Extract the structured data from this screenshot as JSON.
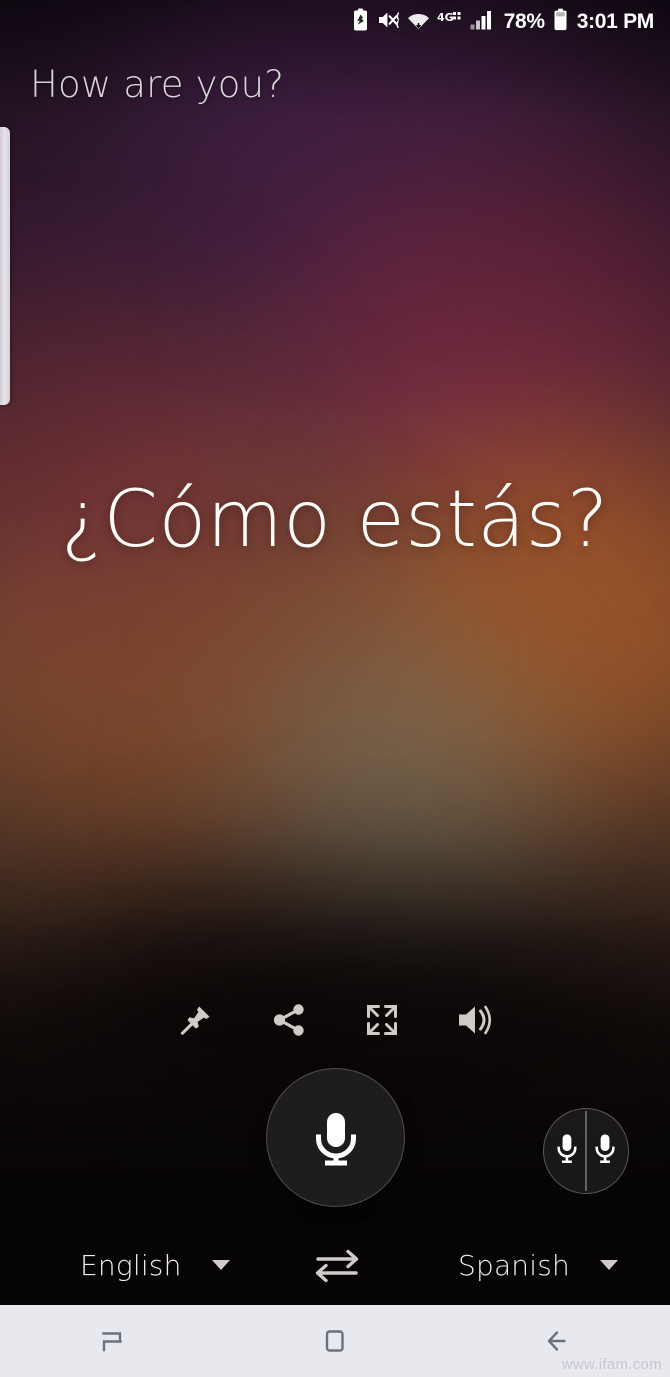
{
  "status_bar": {
    "battery_percent": "78%",
    "time": "3:01 PM",
    "network_label": "4G",
    "network_sub": "LTE",
    "icons": [
      "battery-saver-icon",
      "mute-vibrate-icon",
      "wifi-icon",
      "network-4g-lte-icon",
      "signal-bars-icon",
      "battery-icon"
    ]
  },
  "translation": {
    "source_text": "How are you?",
    "translated_text": "¿Cómo estás?"
  },
  "actions": [
    {
      "name": "pin-icon",
      "label": "Pin"
    },
    {
      "name": "share-icon",
      "label": "Share"
    },
    {
      "name": "fullscreen-icon",
      "label": "Fullscreen"
    },
    {
      "name": "speaker-icon",
      "label": "Listen"
    }
  ],
  "mic": {
    "main_label": "Microphone",
    "dual_label": "Conversation mode"
  },
  "languages": {
    "source": "English",
    "target": "Spanish",
    "swap_label": "Swap languages"
  },
  "navbar": {
    "recents_label": "Recents",
    "home_label": "Home",
    "back_label": "Back",
    "watermark": "www.ifam.com"
  },
  "colors": {
    "nav_background": "#e8e9ef",
    "nav_icon": "#6b6f80",
    "text_primary": "#fdfbf7",
    "accent_circle_border": "rgba(255,255,255,0.22)"
  }
}
